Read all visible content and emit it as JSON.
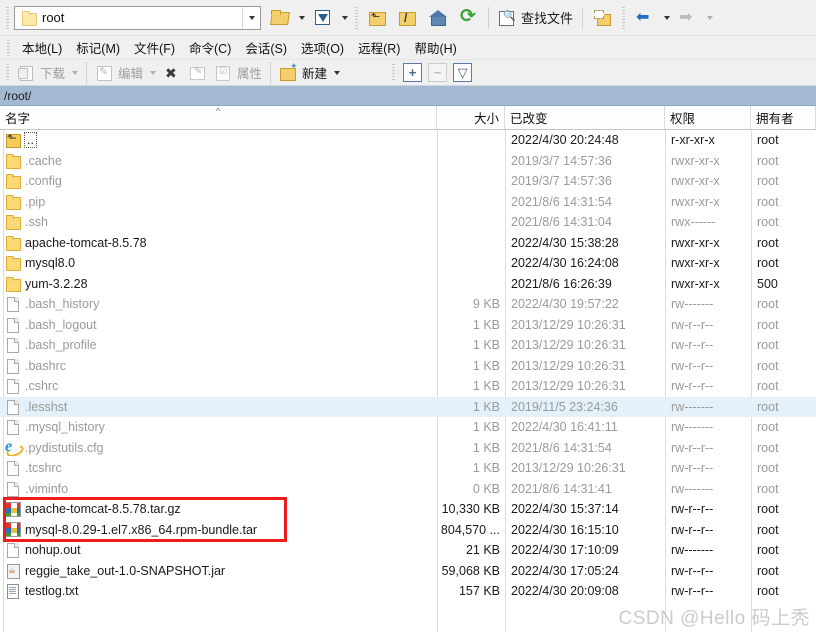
{
  "window": {
    "path_combo_value": "root",
    "path_bar": "/root/"
  },
  "toolbar_top": {
    "open_session_label": "open-session",
    "filter_label": "filter",
    "up_label": "up-directory",
    "root_label": "root-directory",
    "home_label": "home-directory",
    "refresh_label": "refresh",
    "find_files_label": "查找文件",
    "sync_browse_label": "sync-browse",
    "back_label": "back",
    "forward_label": "forward"
  },
  "menubar": {
    "items": [
      {
        "label": "本地(L)"
      },
      {
        "label": "标记(M)"
      },
      {
        "label": "文件(F)"
      },
      {
        "label": "命令(C)"
      },
      {
        "label": "会话(S)"
      },
      {
        "label": "选项(O)"
      },
      {
        "label": "远程(R)"
      },
      {
        "label": "帮助(H)"
      }
    ]
  },
  "toolbar_second": {
    "download": "下载",
    "edit": "编辑",
    "delete": "delete",
    "rename": "rename",
    "properties": "属性",
    "new": "新建",
    "select_add": "+",
    "select_remove": "−",
    "select_invert": "▽"
  },
  "columns": {
    "name": "名字",
    "size": "大小",
    "modified": "已改变",
    "rights": "权限",
    "owner": "拥有者",
    "sort_indicator": "^"
  },
  "files": [
    {
      "icon": "up-folder-icon",
      "name": "..",
      "size": "",
      "modified": "2022/4/30 20:24:48",
      "rights": "r-xr-xr-x",
      "owner": "root",
      "dim": false,
      "selected": false,
      "focus": true
    },
    {
      "icon": "folder-icon",
      "name": ".cache",
      "size": "",
      "modified": "2019/3/7 14:57:36",
      "rights": "rwxr-xr-x",
      "owner": "root",
      "dim": true,
      "selected": false
    },
    {
      "icon": "folder-icon",
      "name": ".config",
      "size": "",
      "modified": "2019/3/7 14:57:36",
      "rights": "rwxr-xr-x",
      "owner": "root",
      "dim": true,
      "selected": false
    },
    {
      "icon": "folder-icon",
      "name": ".pip",
      "size": "",
      "modified": "2021/8/6 14:31:54",
      "rights": "rwxr-xr-x",
      "owner": "root",
      "dim": true,
      "selected": false
    },
    {
      "icon": "folder-icon",
      "name": ".ssh",
      "size": "",
      "modified": "2021/8/6 14:31:04",
      "rights": "rwx------",
      "owner": "root",
      "dim": true,
      "selected": false
    },
    {
      "icon": "folder-icon",
      "name": "apache-tomcat-8.5.78",
      "size": "",
      "modified": "2022/4/30 15:38:28",
      "rights": "rwxr-xr-x",
      "owner": "root",
      "dim": false,
      "selected": false
    },
    {
      "icon": "folder-icon",
      "name": "mysql8.0",
      "size": "",
      "modified": "2022/4/30 16:24:08",
      "rights": "rwxr-xr-x",
      "owner": "root",
      "dim": false,
      "selected": false
    },
    {
      "icon": "folder-icon",
      "name": "yum-3.2.28",
      "size": "",
      "modified": "2021/8/6 16:26:39",
      "rights": "rwxr-xr-x",
      "owner": "500",
      "dim": false,
      "selected": false
    },
    {
      "icon": "file-icon",
      "name": ".bash_history",
      "size": "9 KB",
      "modified": "2022/4/30 19:57:22",
      "rights": "rw-------",
      "owner": "root",
      "dim": true,
      "selected": false
    },
    {
      "icon": "file-icon",
      "name": ".bash_logout",
      "size": "1 KB",
      "modified": "2013/12/29 10:26:31",
      "rights": "rw-r--r--",
      "owner": "root",
      "dim": true,
      "selected": false
    },
    {
      "icon": "file-icon",
      "name": ".bash_profile",
      "size": "1 KB",
      "modified": "2013/12/29 10:26:31",
      "rights": "rw-r--r--",
      "owner": "root",
      "dim": true,
      "selected": false
    },
    {
      "icon": "file-icon",
      "name": ".bashrc",
      "size": "1 KB",
      "modified": "2013/12/29 10:26:31",
      "rights": "rw-r--r--",
      "owner": "root",
      "dim": true,
      "selected": false
    },
    {
      "icon": "file-icon",
      "name": ".cshrc",
      "size": "1 KB",
      "modified": "2013/12/29 10:26:31",
      "rights": "rw-r--r--",
      "owner": "root",
      "dim": true,
      "selected": false
    },
    {
      "icon": "file-icon",
      "name": ".lesshst",
      "size": "1 KB",
      "modified": "2019/11/5 23:24:36",
      "rights": "rw-------",
      "owner": "root",
      "dim": true,
      "selected": true
    },
    {
      "icon": "file-icon",
      "name": ".mysql_history",
      "size": "1 KB",
      "modified": "2022/4/30 16:41:11",
      "rights": "rw-------",
      "owner": "root",
      "dim": true,
      "selected": false
    },
    {
      "icon": "browser-icon",
      "name": ".pydistutils.cfg",
      "size": "1 KB",
      "modified": "2021/8/6 14:31:54",
      "rights": "rw-r--r--",
      "owner": "root",
      "dim": true,
      "selected": false
    },
    {
      "icon": "file-icon",
      "name": ".tcshrc",
      "size": "1 KB",
      "modified": "2013/12/29 10:26:31",
      "rights": "rw-r--r--",
      "owner": "root",
      "dim": true,
      "selected": false
    },
    {
      "icon": "file-icon",
      "name": ".viminfo",
      "size": "0 KB",
      "modified": "2021/8/6 14:31:41",
      "rights": "rw-------",
      "owner": "root",
      "dim": true,
      "selected": false
    },
    {
      "icon": "archive-icon",
      "name": "apache-tomcat-8.5.78.tar.gz",
      "size": "10,330 KB",
      "modified": "2022/4/30 15:37:14",
      "rights": "rw-r--r--",
      "owner": "root",
      "dim": false,
      "selected": false
    },
    {
      "icon": "archive-icon",
      "name": "mysql-8.0.29-1.el7.x86_64.rpm-bundle.tar",
      "size": "804,570 ...",
      "modified": "2022/4/30 16:15:10",
      "rights": "rw-r--r--",
      "owner": "root",
      "dim": false,
      "selected": false
    },
    {
      "icon": "file-icon",
      "name": "nohup.out",
      "size": "21 KB",
      "modified": "2022/4/30 17:10:09",
      "rights": "rw-------",
      "owner": "root",
      "dim": false,
      "selected": false
    },
    {
      "icon": "jar-icon",
      "name": "reggie_take_out-1.0-SNAPSHOT.jar",
      "size": "59,068 KB",
      "modified": "2022/4/30 17:05:24",
      "rights": "rw-r--r--",
      "owner": "root",
      "dim": false,
      "selected": false
    },
    {
      "icon": "text-file-icon",
      "name": "testlog.txt",
      "size": "157 KB",
      "modified": "2022/4/30 20:09:08",
      "rights": "rw-r--r--",
      "owner": "root",
      "dim": false,
      "selected": false
    }
  ],
  "annotation": {
    "highlight_color": "#ee1c1c",
    "highlight_first_index": 18,
    "highlight_last_index": 19
  },
  "watermark": {
    "text": "CSDN @Hello 码上秃"
  }
}
